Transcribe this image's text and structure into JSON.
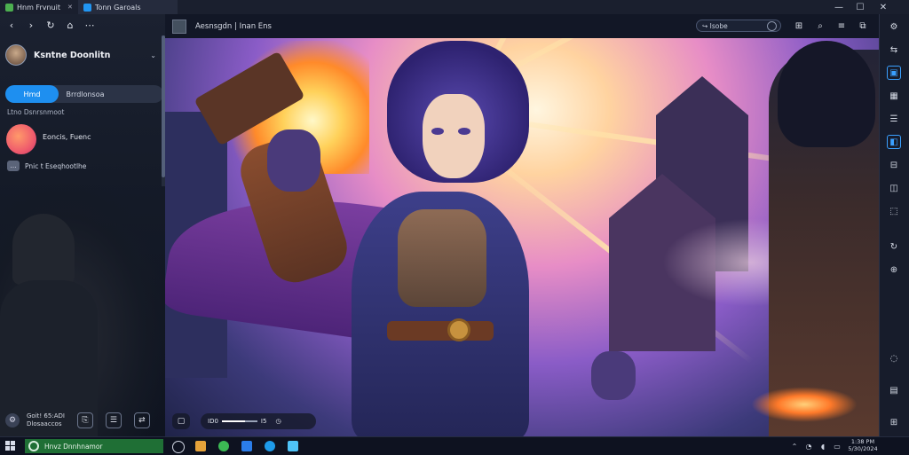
{
  "tabs": [
    {
      "label": "Hnm Frvnuit",
      "close": "✕"
    },
    {
      "label": "Tonn Garoals"
    }
  ],
  "window_controls": {
    "minimize": "—",
    "maximize": "☐",
    "close": "✕"
  },
  "nav": {
    "back": "‹",
    "forward": "›",
    "refresh": "↻",
    "home": "⌂",
    "extensions": "⋯"
  },
  "profile": {
    "name": "Ksntne Doonlitn",
    "chevron": "⌄"
  },
  "left_tabs": {
    "active": "Hmd",
    "inactive": "Brrdlonsoa"
  },
  "section_label": "Ltno  Dsnrsnmoot",
  "featured": {
    "label": "Eoncis, Fuenc"
  },
  "chat": {
    "icon": "…",
    "text": "Pnic t Eseqhootlhe"
  },
  "left_bottom": {
    "line1": "Goit! 65:ADI",
    "line2": "Dlosaaccos",
    "btn1": "⎘",
    "btn2": "☰",
    "btn3": "⇄"
  },
  "viewer": {
    "title": "Aesnsgdn  |  Inan Ens",
    "search_value": "↪ Isobe",
    "header_icons": [
      "⊞",
      "⌕",
      "≡",
      "⧉"
    ]
  },
  "playback": {
    "time": "ID0",
    "speed": "I5",
    "progress": 0.65,
    "left_btn": "▢",
    "rate_btn": "◷"
  },
  "right_toolbar": [
    "⚙",
    "⇆",
    "▣",
    "▦",
    "☰",
    "◧",
    "⊟",
    "◫",
    "⬚",
    "↻",
    "⊕",
    "◌",
    "▤",
    "⊞"
  ],
  "taskbar": {
    "search_text": "Hnvz Dnnhnamor",
    "clock_line1": "1:38 PM",
    "clock_line2": "5/30/2024"
  },
  "colors": {
    "accent": "#1e8ff0",
    "taskbar_search": "#1f6f35"
  }
}
